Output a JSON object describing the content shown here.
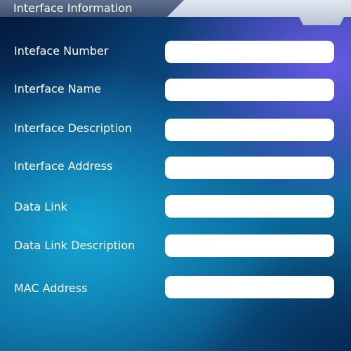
{
  "window": {
    "title": "Interface Information"
  },
  "fields": [
    {
      "label": "Inteface Number",
      "value": ""
    },
    {
      "label": "Interface Name",
      "value": ""
    },
    {
      "label": "Interface Description",
      "value": ""
    },
    {
      "label": "Interface Address",
      "value": ""
    },
    {
      "label": "Data Link",
      "value": ""
    },
    {
      "label": "Data Link Description",
      "value": ""
    },
    {
      "label": "MAC Address",
      "value": ""
    }
  ]
}
